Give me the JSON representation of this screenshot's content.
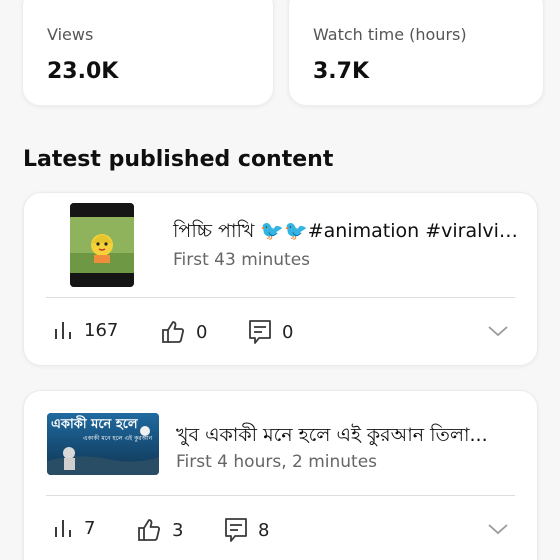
{
  "stats": {
    "views_label": "Views",
    "views_value": "23.0K",
    "watch_label": "Watch time (hours)",
    "watch_value": "3.7K"
  },
  "section": {
    "title": "Latest published content"
  },
  "items": [
    {
      "title": "পিচ্চি পাখি 🐦🐦#animation #viralvid...",
      "subtitle": "First 43 minutes",
      "views": "167",
      "likes": "0",
      "comments": "0"
    },
    {
      "title": "খুব একাকী মনে হলে এই কুরআন তিলা...",
      "subtitle": "First 4 hours, 2 minutes",
      "views": "7",
      "likes": "3",
      "comments": "8",
      "thumb_text": "একাকী মনে হলে",
      "thumb_subtext": "একাকী মনে হলে এই কুরআন"
    }
  ],
  "colors": {
    "icon": "#3a3a3a",
    "chevron": "#9a9a9a"
  },
  "icons": [
    "bar-chart-icon",
    "thumb-up-icon",
    "comment-icon",
    "chevron-down-icon"
  ]
}
